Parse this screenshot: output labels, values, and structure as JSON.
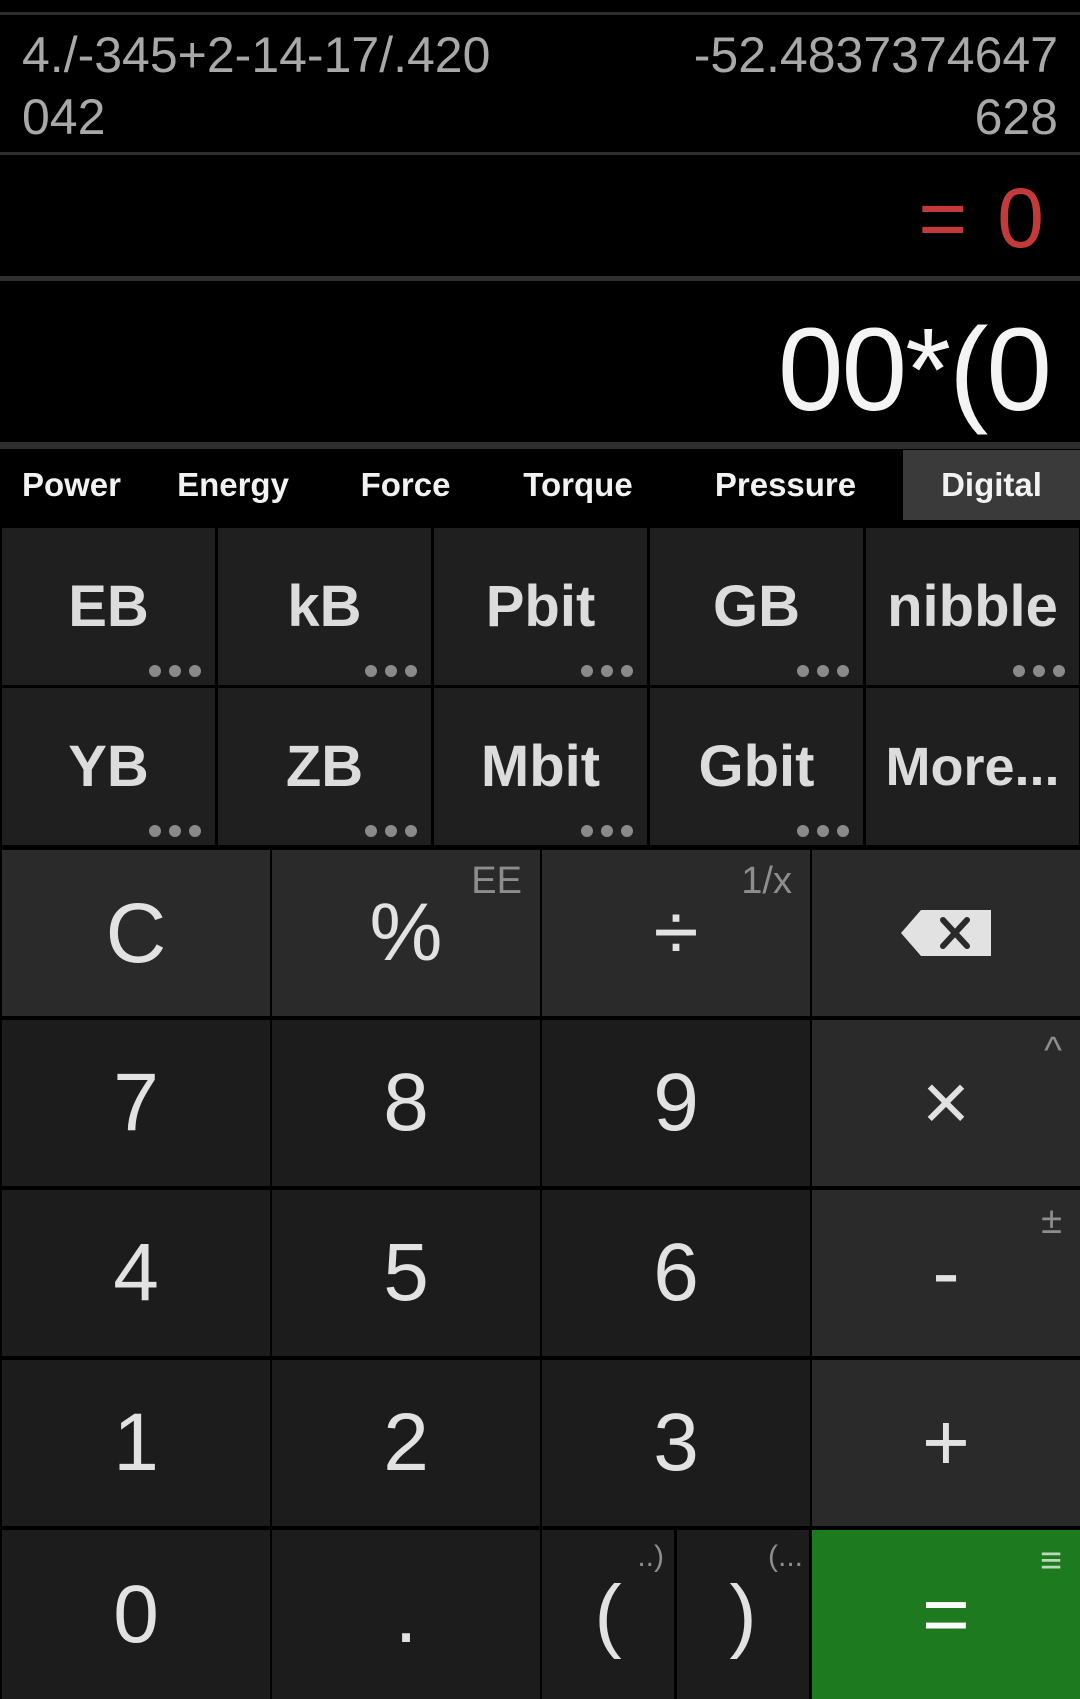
{
  "history": {
    "expression": "4./-345+2-14-17/.420\n042",
    "result": "-52.4837374647\n628"
  },
  "result_display": {
    "equals": "=",
    "value": "0"
  },
  "input": {
    "expression": "00*(0"
  },
  "tabs": [
    {
      "label": "Power",
      "active": false
    },
    {
      "label": "Energy",
      "active": false
    },
    {
      "label": "Force",
      "active": false
    },
    {
      "label": "Torque",
      "active": false
    },
    {
      "label": "Pressure",
      "active": false
    },
    {
      "label": "Digital",
      "active": true
    }
  ],
  "units": {
    "row1": [
      "EB",
      "kB",
      "Pbit",
      "GB",
      "nibble"
    ],
    "row2": [
      "YB",
      "ZB",
      "Mbit",
      "Gbit",
      "More..."
    ]
  },
  "keys": {
    "clear": "C",
    "percent": "%",
    "percent_alt": "EE",
    "divide": "÷",
    "divide_alt": "1/x",
    "backspace_icon": "backspace-icon",
    "d7": "7",
    "d8": "8",
    "d9": "9",
    "multiply": "×",
    "multiply_alt": "^",
    "d4": "4",
    "d5": "5",
    "d6": "6",
    "minus": "-",
    "minus_alt": "±",
    "d1": "1",
    "d2": "2",
    "d3": "3",
    "plus": "+",
    "d0": "0",
    "dot": ".",
    "open_paren": "(",
    "open_paren_alt": "..)",
    "close_paren": ")",
    "close_paren_alt": "(...",
    "equals": "=",
    "equals_alt": "≡"
  },
  "colors": {
    "accent_result": "#c23a3a",
    "equals_key": "#1e7a1e"
  }
}
